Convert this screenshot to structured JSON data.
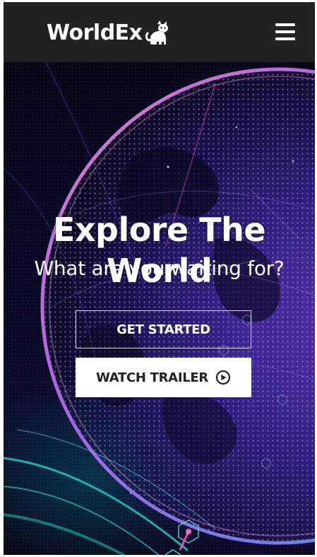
{
  "navbar": {
    "brand": "WorldEx",
    "logo_icon": "cat-icon",
    "menu_icon": "hamburger-menu-icon"
  },
  "hero": {
    "title": "Explore The World",
    "subtitle": "What are you waiting for?",
    "background_image": "glowing-digital-globe"
  },
  "buttons": {
    "get_started": "GET STARTED",
    "watch_trailer": "WATCH TRAILER",
    "watch_trailer_icon": "play-circle-icon"
  },
  "colors": {
    "navbar_bg": "#222222",
    "text": "#ffffff",
    "solid_button_bg": "#ffffff",
    "solid_button_text": "#222222",
    "globe_glow": "#7b3fe0",
    "accent_cyan": "#1fd6c8",
    "accent_pink": "#e05ab8"
  }
}
